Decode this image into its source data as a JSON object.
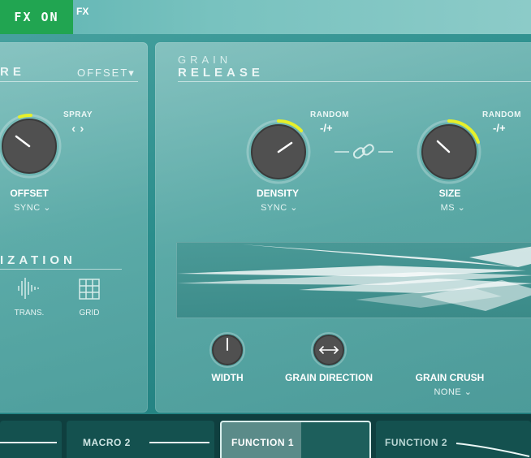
{
  "top_bar": {
    "fx_on_label": "FX ON",
    "fx_tab_label": "FX"
  },
  "left_panel": {
    "section_title": "RE",
    "offset_select": "OFFSET▾",
    "spray_label": "SPRAY",
    "spray_arrows": "‹ ›",
    "offset_knob": {
      "label": "OFFSET",
      "mode": "SYNC ⌄"
    },
    "quantization_title": "IZATION",
    "trans_label": "TRANS.",
    "grid_label": "GRID"
  },
  "right_panel": {
    "title_top": "GRAIN",
    "title_bottom": "RELEASE",
    "density_knob": {
      "label": "DENSITY",
      "mode": "SYNC ⌄",
      "random_label": "RANDOM",
      "random_value": "-/+"
    },
    "size_knob": {
      "label": "SIZE",
      "mode": "MS ⌄",
      "random_label": "RANDOM",
      "random_value": "-/+"
    },
    "width_label": "WIDTH",
    "grain_direction_label": "GRAIN DIRECTION",
    "grain_crush_label": "GRAIN CRUSH",
    "grain_crush_value": "NONE ⌄"
  },
  "bottom_tabs": [
    {
      "label": "MACRO 2"
    },
    {
      "label": "FUNCTION 1"
    },
    {
      "label": "FUNCTION 2"
    }
  ],
  "colors": {
    "accent_yellow": "#e6f02a",
    "fx_on_green": "#21a551",
    "knob_body": "#4d4d4d"
  }
}
